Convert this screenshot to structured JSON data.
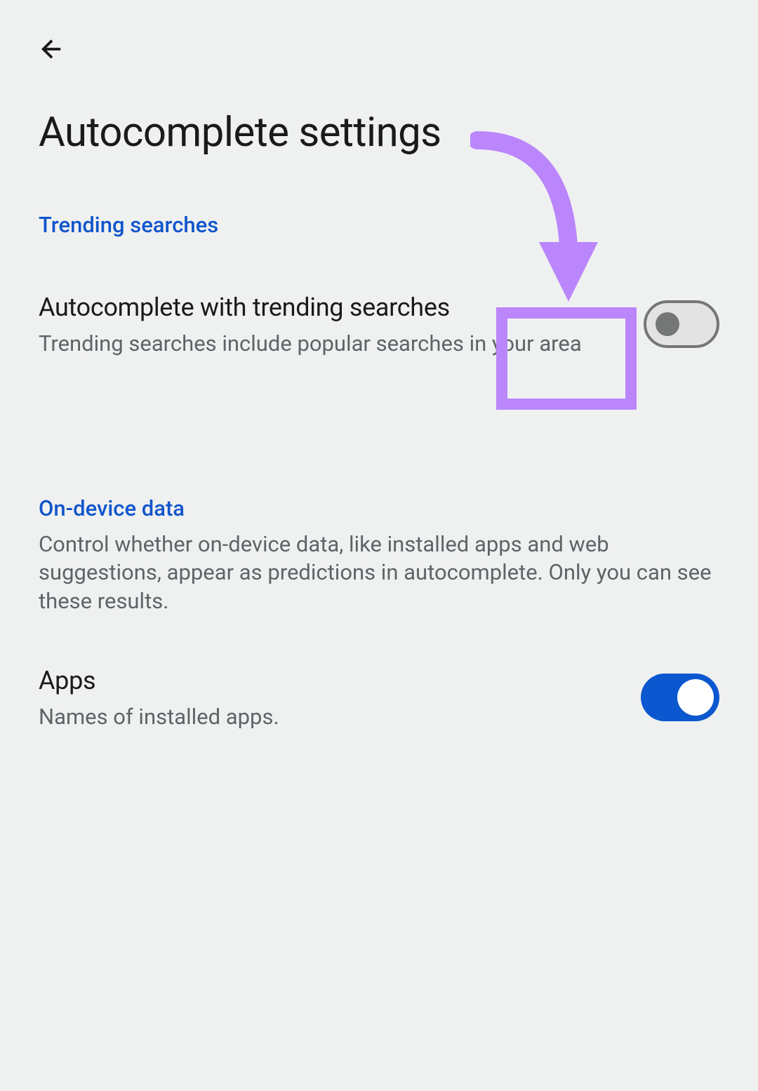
{
  "page_title": "Autocomplete settings",
  "sections": {
    "trending": {
      "header": "Trending searches",
      "setting": {
        "title": "Autocomplete with trending searches",
        "description": "Trending searches include popular searches in your area",
        "enabled": false
      }
    },
    "ondevice": {
      "header": "On-device data",
      "description": "Control whether on-device data, like installed apps and web suggestions, appear as predictions in autocomplete. Only you can see these results.",
      "apps": {
        "title": "Apps",
        "description": "Names of installed apps.",
        "enabled": true
      }
    }
  },
  "annotation": {
    "highlight_color": "#bb86fc",
    "arrow_color": "#bb86fc"
  }
}
